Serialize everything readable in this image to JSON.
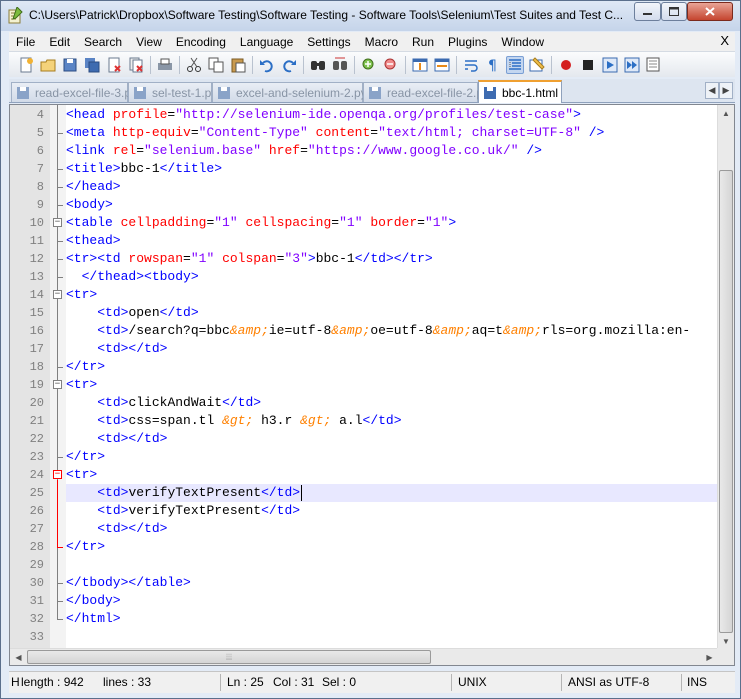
{
  "window": {
    "title": "C:\\Users\\Patrick\\Dropbox\\Software Testing\\Software Testing - Software Tools\\Selenium\\Test Suites and Test C..."
  },
  "menu": [
    "File",
    "Edit",
    "Search",
    "View",
    "Encoding",
    "Language",
    "Settings",
    "Macro",
    "Run",
    "Plugins",
    "Window"
  ],
  "menu_close": "X",
  "toolbar": [
    "new-file",
    "open-file",
    "save",
    "save-all",
    "close",
    "close-all",
    "print",
    "cut",
    "copy",
    "paste",
    "undo",
    "redo",
    "find",
    "replace",
    "zoom-in",
    "zoom-out",
    "sync-vertical",
    "sync-horizontal",
    "word-wrap",
    "show-all-chars",
    "indent-guide",
    "user-defined-lang",
    "record-macro",
    "stop-record",
    "play-macro",
    "run-macro-multiple",
    "save-macro"
  ],
  "tabs": [
    {
      "label": "read-excel-file-3.py",
      "active": false
    },
    {
      "label": "sel-test-1.py",
      "active": false
    },
    {
      "label": "excel-and-selenium-2.py",
      "active": false
    },
    {
      "label": "read-excel-file-2.py",
      "active": false
    },
    {
      "label": "bbc-1.html",
      "active": true
    }
  ],
  "editor": {
    "current_line": 25,
    "lines": [
      {
        "n": "4",
        "parts": [
          [
            "t",
            "<head "
          ],
          [
            "a",
            "profile"
          ],
          [
            "x",
            "="
          ],
          [
            "v",
            "\"http://selenium-ide.openqa.org/profiles/test-case\""
          ],
          [
            "t",
            ">"
          ]
        ]
      },
      {
        "n": "5",
        "parts": [
          [
            "t",
            "<meta "
          ],
          [
            "a",
            "http-equiv"
          ],
          [
            "x",
            "="
          ],
          [
            "v",
            "\"Content-Type\""
          ],
          [
            "x",
            " "
          ],
          [
            "a",
            "content"
          ],
          [
            "x",
            "="
          ],
          [
            "v",
            "\"text/html; charset=UTF-8\""
          ],
          [
            "x",
            " "
          ],
          [
            "t",
            "/>"
          ]
        ]
      },
      {
        "n": "6",
        "parts": [
          [
            "t",
            "<link "
          ],
          [
            "a",
            "rel"
          ],
          [
            "x",
            "="
          ],
          [
            "v",
            "\"selenium.base\""
          ],
          [
            "x",
            " "
          ],
          [
            "a",
            "href"
          ],
          [
            "x",
            "="
          ],
          [
            "v",
            "\"https://www.google.co.uk/\""
          ],
          [
            "x",
            " "
          ],
          [
            "t",
            "/>"
          ]
        ]
      },
      {
        "n": "7",
        "parts": [
          [
            "t",
            "<title>"
          ],
          [
            "x",
            "bbc-1"
          ],
          [
            "t",
            "</title>"
          ]
        ]
      },
      {
        "n": "8",
        "parts": [
          [
            "t",
            "</head>"
          ]
        ]
      },
      {
        "n": "9",
        "parts": [
          [
            "t",
            "<body>"
          ]
        ]
      },
      {
        "n": "10",
        "parts": [
          [
            "t",
            "<table "
          ],
          [
            "a",
            "cellpadding"
          ],
          [
            "x",
            "="
          ],
          [
            "v",
            "\"1\""
          ],
          [
            "x",
            " "
          ],
          [
            "a",
            "cellspacing"
          ],
          [
            "x",
            "="
          ],
          [
            "v",
            "\"1\""
          ],
          [
            "x",
            " "
          ],
          [
            "a",
            "border"
          ],
          [
            "x",
            "="
          ],
          [
            "v",
            "\"1\""
          ],
          [
            "t",
            ">"
          ]
        ]
      },
      {
        "n": "11",
        "parts": [
          [
            "t",
            "<thead>"
          ]
        ]
      },
      {
        "n": "12",
        "parts": [
          [
            "t",
            "<tr><td "
          ],
          [
            "a",
            "rowspan"
          ],
          [
            "x",
            "="
          ],
          [
            "v",
            "\"1\""
          ],
          [
            "x",
            " "
          ],
          [
            "a",
            "colspan"
          ],
          [
            "x",
            "="
          ],
          [
            "v",
            "\"3\""
          ],
          [
            "t",
            ">"
          ],
          [
            "x",
            "bbc-1"
          ],
          [
            "t",
            "</td></tr>"
          ]
        ]
      },
      {
        "n": "13",
        "parts": [
          [
            "x",
            "  "
          ],
          [
            "t",
            "</thead><tbody>"
          ]
        ]
      },
      {
        "n": "14",
        "parts": [
          [
            "t",
            "<tr>"
          ]
        ]
      },
      {
        "n": "15",
        "parts": [
          [
            "x",
            "    "
          ],
          [
            "t",
            "<td>"
          ],
          [
            "x",
            "open"
          ],
          [
            "t",
            "</td>"
          ]
        ]
      },
      {
        "n": "16",
        "parts": [
          [
            "x",
            "    "
          ],
          [
            "t",
            "<td>"
          ],
          [
            "x",
            "/search?q=bbc"
          ],
          [
            "e",
            "&amp;"
          ],
          [
            "x",
            "ie=utf-8"
          ],
          [
            "e",
            "&amp;"
          ],
          [
            "x",
            "oe=utf-8"
          ],
          [
            "e",
            "&amp;"
          ],
          [
            "x",
            "aq=t"
          ],
          [
            "e",
            "&amp;"
          ],
          [
            "x",
            "rls=org.mozilla:en-"
          ]
        ]
      },
      {
        "n": "17",
        "parts": [
          [
            "x",
            "    "
          ],
          [
            "t",
            "<td></td>"
          ]
        ]
      },
      {
        "n": "18",
        "parts": [
          [
            "t",
            "</tr>"
          ]
        ]
      },
      {
        "n": "19",
        "parts": [
          [
            "t",
            "<tr>"
          ]
        ]
      },
      {
        "n": "20",
        "parts": [
          [
            "x",
            "    "
          ],
          [
            "t",
            "<td>"
          ],
          [
            "x",
            "clickAndWait"
          ],
          [
            "t",
            "</td>"
          ]
        ]
      },
      {
        "n": "21",
        "parts": [
          [
            "x",
            "    "
          ],
          [
            "t",
            "<td>"
          ],
          [
            "x",
            "css=span.tl "
          ],
          [
            "e",
            "&gt;"
          ],
          [
            "x",
            " h3.r "
          ],
          [
            "e",
            "&gt;"
          ],
          [
            "x",
            " a.l"
          ],
          [
            "t",
            "</td>"
          ]
        ]
      },
      {
        "n": "22",
        "parts": [
          [
            "x",
            "    "
          ],
          [
            "t",
            "<td></td>"
          ]
        ]
      },
      {
        "n": "23",
        "parts": [
          [
            "t",
            "</tr>"
          ]
        ]
      },
      {
        "n": "24",
        "parts": [
          [
            "t",
            "<tr>"
          ]
        ]
      },
      {
        "n": "25",
        "parts": [
          [
            "x",
            "    "
          ],
          [
            "t",
            "<td>"
          ],
          [
            "x",
            "verifyTextPresent"
          ],
          [
            "t",
            "</td>"
          ]
        ]
      },
      {
        "n": "26",
        "parts": [
          [
            "x",
            "    "
          ],
          [
            "t",
            "<td>"
          ],
          [
            "x",
            "verifyTextPresent"
          ],
          [
            "t",
            "</td>"
          ]
        ]
      },
      {
        "n": "27",
        "parts": [
          [
            "x",
            "    "
          ],
          [
            "t",
            "<td></td>"
          ]
        ]
      },
      {
        "n": "28",
        "parts": [
          [
            "t",
            "</tr>"
          ]
        ]
      },
      {
        "n": "29",
        "parts": []
      },
      {
        "n": "30",
        "parts": [
          [
            "t",
            "</tbody></table>"
          ]
        ]
      },
      {
        "n": "31",
        "parts": [
          [
            "t",
            "</body>"
          ]
        ]
      },
      {
        "n": "32",
        "parts": [
          [
            "t",
            "</html>"
          ]
        ]
      },
      {
        "n": "33",
        "parts": []
      }
    ]
  },
  "status": {
    "length": "Hyper Text Markup Language file",
    "length_short": "H",
    "length_value": "length : 942",
    "lines_value": "lines : 33",
    "ln": "Ln : 25",
    "col": "Col : 31",
    "sel": "Sel : 0",
    "eol": "UNIX",
    "encoding": "ANSI as UTF-8",
    "mode": "INS"
  },
  "colors": {
    "tag": "#0000ff",
    "attr": "#ff0000",
    "value": "#8000ff",
    "entity": "#ff8000",
    "current_line": "#e8e8ff"
  }
}
